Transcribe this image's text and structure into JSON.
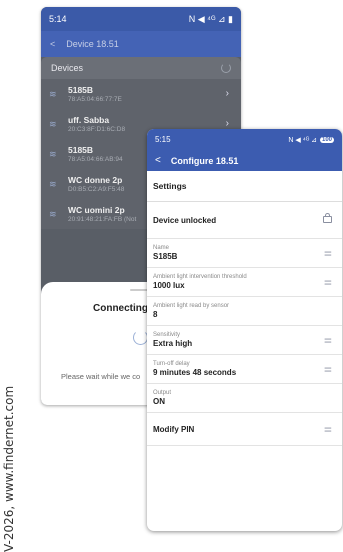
{
  "watermark": "V-2026, www.findernet.com",
  "back_phone": {
    "time": "5:14",
    "status_icons": "N ◀ ⁴ᴳ ⊿ ▮",
    "title": "Device 18.51",
    "devices_header": "Devices",
    "devices": [
      {
        "name": "5185B",
        "mac": "78:A5:04:66:77:7E"
      },
      {
        "name": "uff. Sabba",
        "mac": "20:C3:8F:D1:6C:D8"
      },
      {
        "name": "5185B",
        "mac": "78:A5:04:66:AB:94"
      },
      {
        "name": "WC donne 2p",
        "mac": "D0:B5:C2:A9:F5:48"
      },
      {
        "name": "WC uomini 2p",
        "mac": "20:91:48:21:FA:FB (Not"
      }
    ],
    "sheet_title": "Connecting t",
    "sheet_message": "Please wait while we co"
  },
  "front_phone": {
    "time": "5:15",
    "status_icons": "N ◀ ⁴ᴳ ⊿",
    "battery": "100",
    "title": "Configure 18.51",
    "section_header": "Settings",
    "rows": [
      {
        "label": "",
        "value": "Device unlocked",
        "icon": "lock-icon"
      },
      {
        "label": "Name",
        "value": "S185B",
        "icon": "slider-icon"
      },
      {
        "label": "Ambient light intervention threshold",
        "value": "1000 lux",
        "icon": "slider-icon"
      },
      {
        "label": "Ambient light read by sensor",
        "value": "8",
        "icon": ""
      },
      {
        "label": "Sensitivity",
        "value": "Extra high",
        "icon": "slider-icon"
      },
      {
        "label": "Turn-off delay",
        "value": "9 minutes 48 seconds",
        "icon": "slider-icon"
      },
      {
        "label": "Output",
        "value": "ON",
        "icon": ""
      },
      {
        "label": "",
        "value": "Modify PIN",
        "icon": "slider-icon"
      }
    ]
  }
}
